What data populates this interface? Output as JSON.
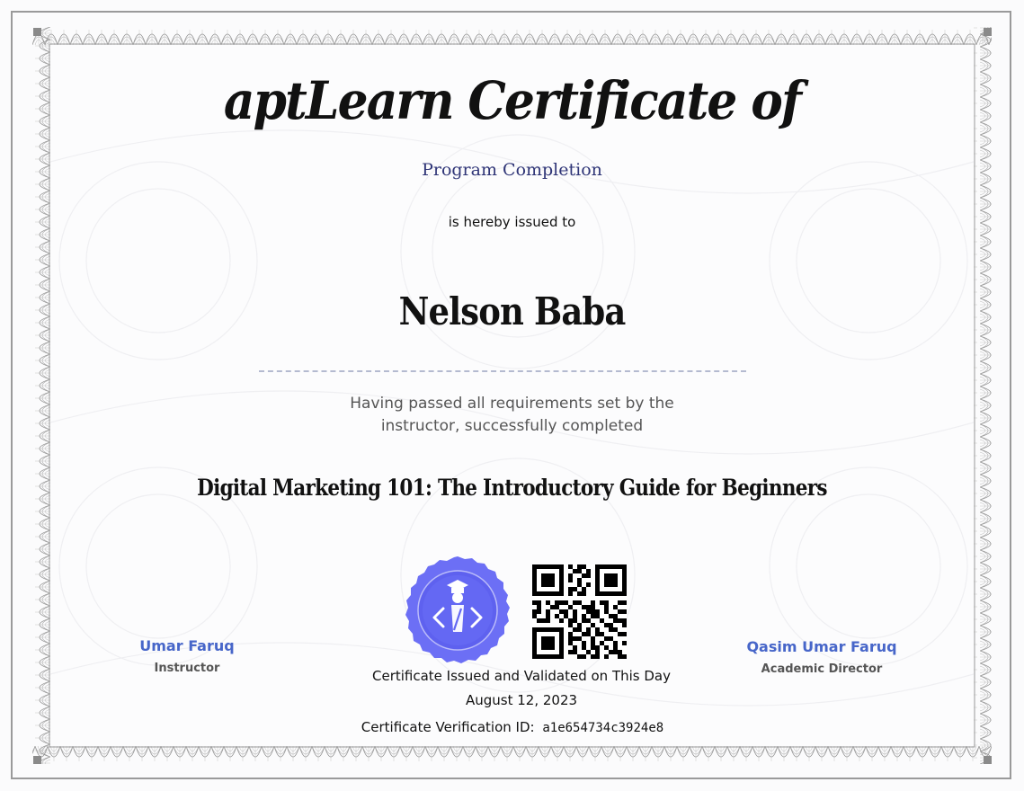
{
  "certificate": {
    "title": "aptLearn Certificate of",
    "subtitle": "Program Completion",
    "issued_to_label": "is hereby issued to",
    "recipient_name": "Nelson Baba",
    "passed_line_1": "Having passed all requirements set by the",
    "passed_line_2": "instructor, successfully completed",
    "course_name": "Digital Marketing 101: The Introductory Guide for Beginners",
    "issued_validated_label": "Certificate Issued and Validated on This Day",
    "issue_date": "August 12, 2023",
    "verification_label": "Certificate Verification ID:",
    "verification_id": "a1e654734c3924e8"
  },
  "signatories": {
    "left": {
      "name": "Umar Faruq",
      "role": "Instructor"
    },
    "right": {
      "name": "Qasim Umar Faruq",
      "role": "Academic Director"
    }
  },
  "badge": {
    "icon": "graduate-code-badge-icon",
    "color": "#6c6ff5"
  },
  "qr_code": {
    "icon": "qr-code-icon"
  },
  "colors": {
    "subtitle": "#2f3577",
    "signatory_name": "#4766c9",
    "border": "#9a9a9a",
    "badge": "#6c6ff5"
  }
}
